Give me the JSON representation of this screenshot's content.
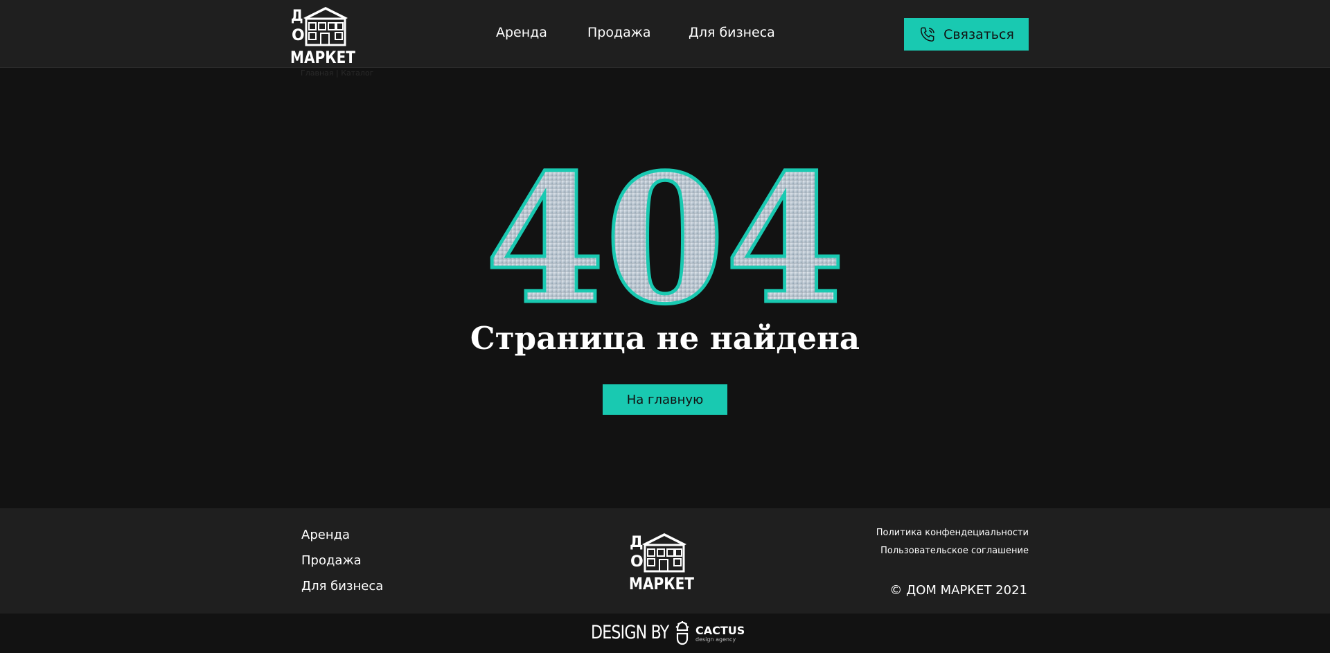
{
  "header": {
    "logo_text": "ДОМ МАРКЕТ",
    "nav": [
      "Аренда",
      "Продажа",
      "Для бизнеса"
    ],
    "contact_label": "Связаться",
    "breadcrumb": "Главная | Каталог"
  },
  "main": {
    "code": "404",
    "title": "Страница не найдена",
    "home_button": "На главную"
  },
  "footer": {
    "nav": [
      "Аренда",
      "Продажа",
      "Для бизнеса"
    ],
    "legal": [
      "Политика конфендециальности",
      "Пользовательское соглашение"
    ],
    "copyright": "© ДОМ МАРКЕТ 2021",
    "design_by": "DESIGN BY",
    "agency_name": "CACTUS",
    "agency_sub": "design agency"
  },
  "colors": {
    "accent": "#19c9b1",
    "background": "#121212",
    "panel": "#1f1f1f"
  },
  "icons": [
    "phone-icon",
    "cactus-icon"
  ]
}
